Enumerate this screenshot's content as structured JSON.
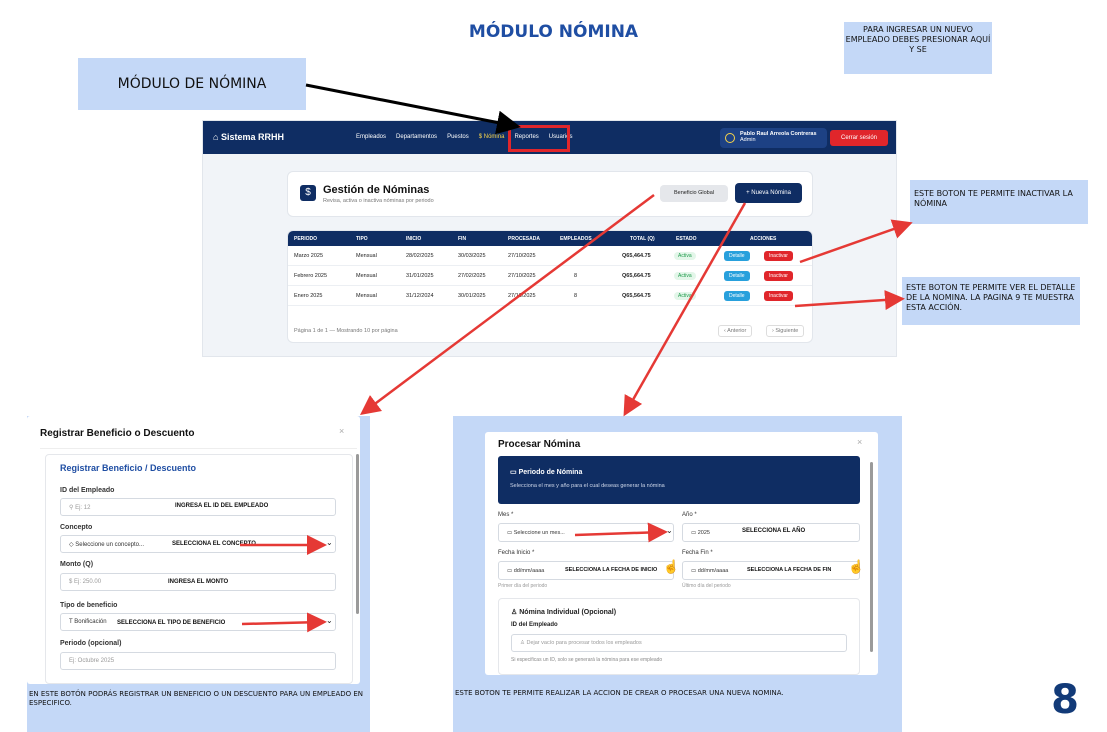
{
  "header": {
    "title": "MÓDULO NÓMINA"
  },
  "callouts": {
    "modulo_label": "MÓDULO DE NÓMINA",
    "nuevo_empleado": "PARA INGRESAR UN NUEVO EMPLEADO DEBES PRESIONAR AQUÍ Y SE",
    "inactivar": "ESTE BOTON TE PERMITE INACTIVAR LA NÓMINA",
    "detalle": "ESTE BOTON TE PERMITE VER EL DETALLE DE LA NOMINA. LA PAGINA 9 TE MUESTRA ESTA ACCIÓN."
  },
  "app": {
    "brand": "Sistema RRHH",
    "nav": [
      "Empleados",
      "Departamentos",
      "Puestos",
      "$ Nómina",
      "Reportes",
      "Usuarios"
    ],
    "user_name": "Pablo Raul Arreola Contreras",
    "user_role": "Admin",
    "logout": "Cerrar sesión",
    "page_title": "Gestión de Nóminas",
    "page_subtitle": "Revisa, activa o inactiva nóminas por periodo",
    "btn_beneficio": "Beneficio Global",
    "btn_nueva": "+ Nueva Nómina",
    "columns": [
      "PERIODO",
      "TIPO",
      "INICIO",
      "FIN",
      "PROCESADA",
      "EMPLEADOS",
      "TOTAL (Q)",
      "ESTADO",
      "ACCIONES"
    ],
    "rows": [
      {
        "periodo": "Marzo 2025",
        "tipo": "Mensual",
        "inicio": "28/02/2025",
        "fin": "30/03/2025",
        "procesada": "27/10/2025",
        "empleados": "",
        "total": "Q65,464.75",
        "estado": "Activa"
      },
      {
        "periodo": "Febrero 2025",
        "tipo": "Mensual",
        "inicio": "31/01/2025",
        "fin": "27/02/2025",
        "procesada": "27/10/2025",
        "empleados": "8",
        "total": "Q65,664.75",
        "estado": "Activa"
      },
      {
        "periodo": "Enero 2025",
        "tipo": "Mensual",
        "inicio": "31/12/2024",
        "fin": "30/01/2025",
        "procesada": "27/10/2025",
        "empleados": "8",
        "total": "Q65,564.75",
        "estado": "Activa"
      }
    ],
    "btn_detalle": "Detalle",
    "btn_inactivar": "Inactivar",
    "pagination": "Página 1 de 1 — Mostrando 10 por página",
    "prev": "Anterior",
    "next": "Siguiente"
  },
  "beneficio_modal": {
    "title": "Registrar Beneficio o Descuento",
    "subtitle": "Registrar Beneficio / Descuento",
    "id_label": "ID del Empleado",
    "id_placeholder": "Ej: 12",
    "id_note": "INGRESA EL ID DEL EMPLEADO",
    "concepto_label": "Concepto",
    "concepto_value": "Seleccione un concepto...",
    "concepto_note": "SELECCIONA EL CONCEPTO",
    "monto_label": "Monto (Q)",
    "monto_placeholder": "Ej: 250.00",
    "monto_note": "INGRESA EL MONTO",
    "tipo_label": "Tipo de beneficio",
    "tipo_value": "Bonificación",
    "tipo_note": "SELECCIONA EL TIPO DE BENEFICIO",
    "periodo_label": "Periodo (opcional)",
    "periodo_placeholder": "Ej: Octubre 2025",
    "caption": "EN ESTE BOTÓN PODRÁS REGISTRAR UN BENEFICIO O UN DESCUENTO PARA UN EMPLEADO EN ESPECIFICO."
  },
  "procesar_modal": {
    "title": "Procesar Nómina",
    "period_title": "Periodo de Nómina",
    "period_sub": "Selecciona el mes y año para el cual deseas generar la nómina",
    "mes_label": "Mes *",
    "mes_value": "Seleccione un mes...",
    "anio_label": "Año *",
    "anio_value": "2025",
    "anio_note": "SELECCIONA EL AÑO",
    "inicio_label": "Fecha Inicio *",
    "inicio_value": "dd/mm/aaaa",
    "inicio_note": "SELECCIONA LA FECHA DE INICIO",
    "inicio_help": "Primer día del periodo",
    "fin_label": "Fecha Fin *",
    "fin_value": "dd/mm/aaaa",
    "fin_note": "SELECCIONA LA FECHA DE FIN",
    "fin_help": "Último día del periodo",
    "individual_title": "Nómina Individual (Opcional)",
    "emp_label": "ID del Empleado",
    "emp_placeholder": "Dejar vacío para procesar todos los empleados",
    "emp_help": "Si especificas un ID, solo se generará la nómina para ese empleado",
    "caption": "ESTE BOTON TE PERMITE REALIZAR LA ACCION DE CREAR O PROCESAR UNA NUEVA NOMINA."
  },
  "page_number": "8"
}
